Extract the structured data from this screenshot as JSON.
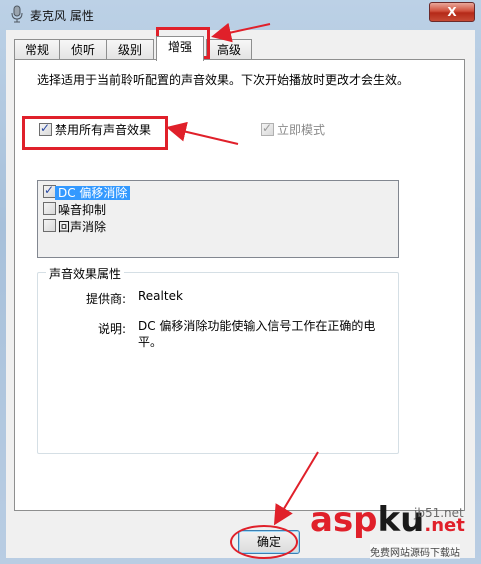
{
  "window": {
    "title": "麦克风 属性",
    "close_label": "X"
  },
  "tabs": [
    {
      "label": "常规",
      "active": false
    },
    {
      "label": "侦听",
      "active": false
    },
    {
      "label": "级别",
      "active": false
    },
    {
      "label": "增强",
      "active": true
    },
    {
      "label": "高级",
      "active": false
    }
  ],
  "enhancement": {
    "description": "选择适用于当前聆听配置的声音效果。下次开始播放时更改才会生效。",
    "disable_all_label": "禁用所有声音效果",
    "disable_all_checked": true,
    "immediate_mode_label": "立即模式",
    "immediate_mode_checked": true,
    "effects": [
      {
        "label": "DC 偏移消除",
        "checked": true,
        "selected": true
      },
      {
        "label": "噪音抑制",
        "checked": false,
        "selected": false
      },
      {
        "label": "回声消除",
        "checked": false,
        "selected": false
      }
    ]
  },
  "properties": {
    "group_title": "声音效果属性",
    "provider_label": "提供商:",
    "provider_value": "Realtek",
    "description_label": "说明:",
    "description_value": "DC 偏移消除功能使输入信号工作在正确的电平。"
  },
  "buttons": {
    "ok_label": "确定"
  },
  "watermark": {
    "text_asp": "asp",
    "text_ku": "ku",
    "text_net": ".net",
    "site": "jb51.net",
    "subtitle": "免费网站源码下载站"
  },
  "colors": {
    "annotation": "#e0202a",
    "selection": "#3399ff"
  }
}
